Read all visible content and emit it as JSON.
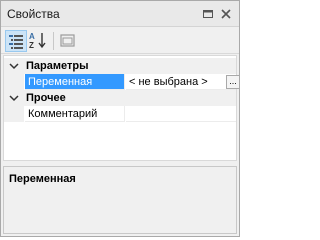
{
  "window": {
    "title": "Свойства"
  },
  "toolbar": {
    "tools": [
      {
        "name": "categorized-view",
        "icon": "categorized-icon",
        "active": true
      },
      {
        "name": "alphabetical-sort",
        "icon": "sort-az-icon",
        "active": false
      },
      {
        "name": "property-pages",
        "icon": "property-pages-icon",
        "active": false
      }
    ]
  },
  "grid": {
    "categories": [
      {
        "label": "Параметры",
        "properties": [
          {
            "name": "Переменная",
            "value": "< не выбрана >",
            "selected": true,
            "has_button": true,
            "button_label": "..."
          }
        ]
      },
      {
        "label": "Прочее",
        "properties": [
          {
            "name": "Комментарий",
            "value": "",
            "selected": false
          }
        ]
      }
    ]
  },
  "description": {
    "title": "Переменная"
  },
  "colors": {
    "selection": "#3399ff",
    "active_tool": "#cce4f7",
    "panel_bg": "#f0f0f0"
  }
}
